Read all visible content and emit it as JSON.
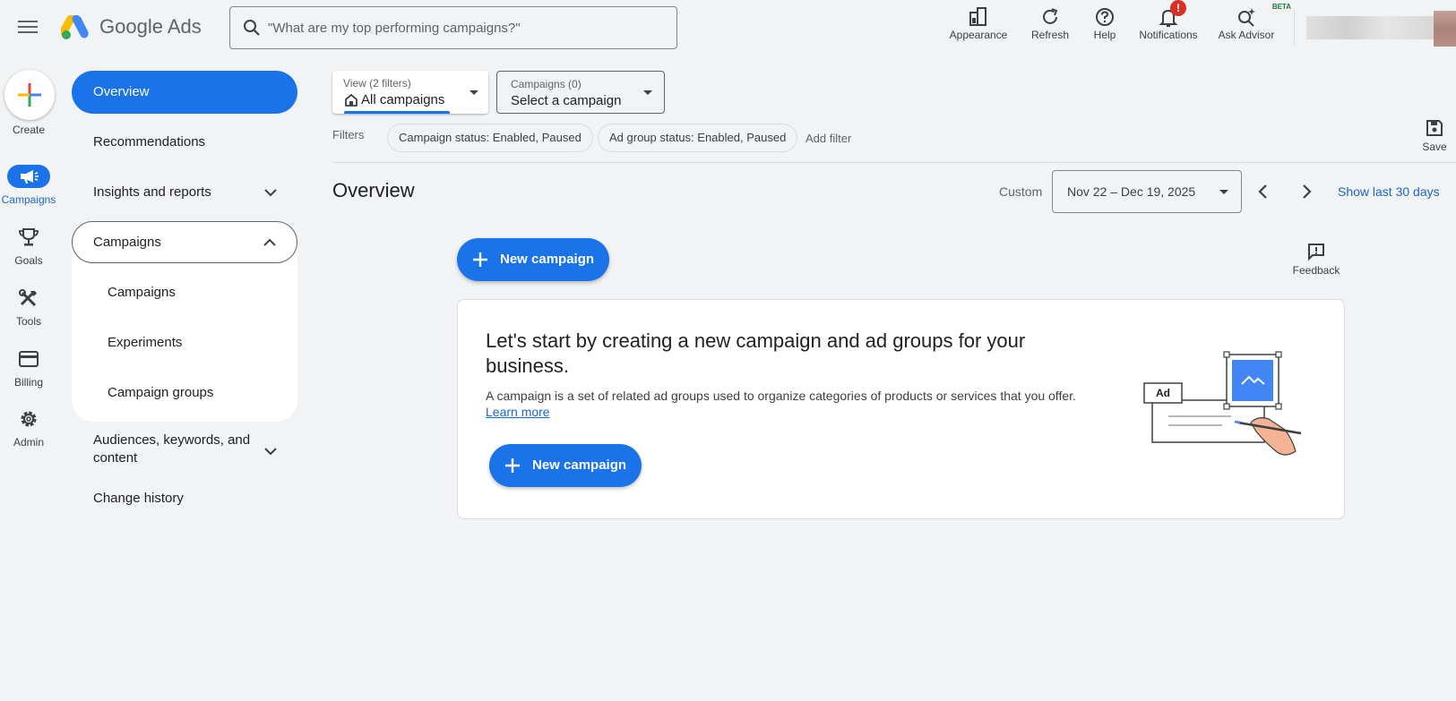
{
  "header": {
    "brand": "Google Ads",
    "search_placeholder": "\"What are my top performing campaigns?\"",
    "buttons": {
      "appearance": "Appearance",
      "refresh": "Refresh",
      "help": "Help",
      "notifications": "Notifications",
      "notifications_badge": "!",
      "ask_advisor": "Ask Advisor",
      "beta": "BETA"
    }
  },
  "rail": {
    "create": "Create",
    "campaigns": "Campaigns",
    "goals": "Goals",
    "tools": "Tools",
    "billing": "Billing",
    "admin": "Admin"
  },
  "nav": {
    "overview": "Overview",
    "recommendations": "Recommendations",
    "insights": "Insights and reports",
    "campaigns_group": "Campaigns",
    "sub_items": [
      "Campaigns",
      "Experiments",
      "Campaign groups"
    ],
    "audiences_line1": "Audiences, keywords, and",
    "audiences_line2": "content",
    "change_history": "Change history"
  },
  "toolbar": {
    "view_small": "View (2 filters)",
    "view_main": "All campaigns",
    "campaigns_small": "Campaigns (0)",
    "campaigns_main": "Select a campaign",
    "filters_label": "Filters",
    "chips": [
      "Campaign status: Enabled, Paused",
      "Ad group status: Enabled, Paused"
    ],
    "add_filter": "Add filter",
    "save": "Save"
  },
  "main": {
    "title": "Overview",
    "custom_label": "Custom",
    "date_range": "Nov 22 – Dec 19, 2025",
    "show_last": "Show last 30 days",
    "new_campaign": "New campaign",
    "feedback": "Feedback"
  },
  "card": {
    "title": "Let's start by creating a new campaign and ad groups for your business.",
    "description": "A campaign is a set of related ad groups used to organize categories of products or services that you offer.",
    "learn_more": "Learn more",
    "button": "New campaign",
    "illustration_label": "Ad"
  },
  "colors": {
    "accent": "#1a73e8",
    "background": "#f1f3f4",
    "badge": "#d93025"
  },
  "icons": [
    "menu-icon",
    "google-ads-logo",
    "search-icon",
    "appearance-icon",
    "refresh-icon",
    "help-icon",
    "bell-icon",
    "advisor-sparkle-icon",
    "plus-icon",
    "megaphone-icon",
    "trophy-icon",
    "tools-icon",
    "credit-card-icon",
    "gear-icon",
    "chevron-down-icon",
    "chevron-up-icon",
    "home-icon",
    "save-icon",
    "chevron-left-icon",
    "chevron-right-icon",
    "feedback-icon"
  ]
}
